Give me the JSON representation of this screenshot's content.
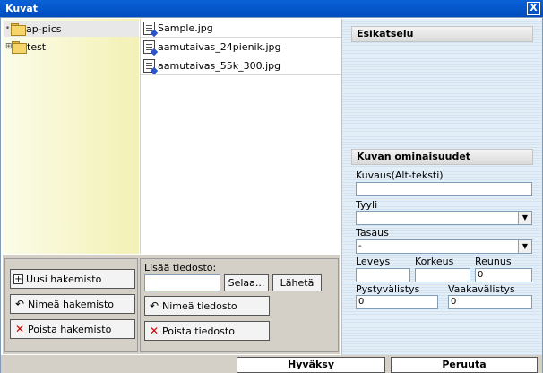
{
  "window": {
    "title": "Kuvat",
    "close_label": "X"
  },
  "tree": {
    "items": [
      {
        "toggle": "•",
        "label": "ap-pics"
      },
      {
        "toggle": "⊞",
        "label": "test"
      }
    ]
  },
  "files": {
    "items": [
      {
        "name": "Sample.jpg"
      },
      {
        "name": "aamutaivas_24pienik.jpg"
      },
      {
        "name": "aamutaivas_55k_300.jpg"
      }
    ]
  },
  "preview": {
    "heading": "Esikatselu"
  },
  "properties": {
    "heading": "Kuvan ominaisuudet",
    "alt_label": "Kuvaus(Alt-teksti)",
    "alt_value": "",
    "style_label": "Tyyli",
    "style_value": "",
    "align_label": "Tasaus",
    "align_value": "-",
    "width_label": "Leveys",
    "width_value": "",
    "height_label": "Korkeus",
    "height_value": "",
    "border_label": "Reunus",
    "border_value": "0",
    "vspace_label": "Pystyvälistys",
    "vspace_value": "0",
    "hspace_label": "Vaakavälistys",
    "hspace_value": "0"
  },
  "folder_actions": {
    "new_folder": "Uusi hakemisto",
    "rename_folder": "Nimeä hakemisto",
    "delete_folder": "Poista hakemisto"
  },
  "file_actions": {
    "add_file_label": "Lisää tiedosto:",
    "file_value": "",
    "browse": "Selaa...",
    "upload": "Lähetä",
    "rename_file": "Nimeä tiedosto",
    "delete_file": "Poista tiedosto"
  },
  "footer": {
    "ok": "Hyväksy",
    "cancel": "Peruuta"
  }
}
